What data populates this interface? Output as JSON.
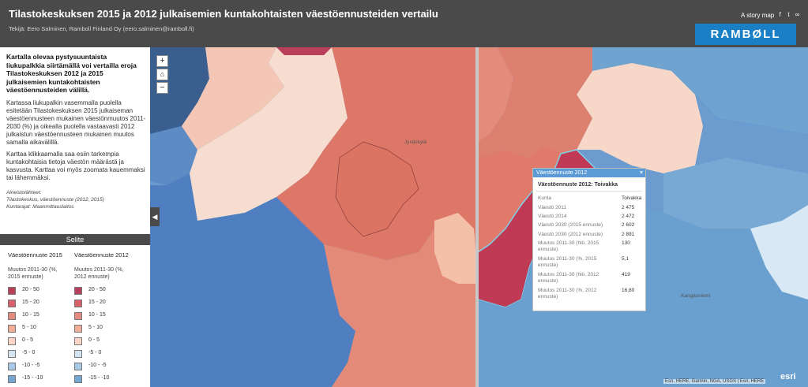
{
  "header": {
    "title": "Tilastokeskuksen 2015 ja 2012 julkaisemien kuntakohtaisten väestöennusteiden vertailu",
    "author": "Tekijä: Eero Salminen, Ramboll Finland Oy (eero.salminen@ramboll.fi)",
    "story_map": "A story map",
    "share_icons": [
      "facebook-icon",
      "twitter-icon",
      "link-icon"
    ],
    "logo": "RAMBØLL"
  },
  "panel": {
    "intro_bold": "Kartalla olevaa pystysuuntaista liukupalkkia siirtämällä voi vertailla eroja Tilastokeskuksen 2012 ja 2015 julkaisemien kuntakohtaisten väestöennusteiden välillä.",
    "p1": "Kartassa liukupalkin vasemmalla puolella esitetään Tilastokeskuksen 2015 julkaiseman väestöennusteen mukainen väestönmuutos 2011-2030 (%) ja oikealla puolella vastaavasti 2012 julkaistun väestöennusteen mukainen muutos samalla aikavälillä.",
    "p2": "Karttaa klikkaamalla saa esiin tarkempia kuntakohtaisia tietoja väestön määrästä ja kasvusta. Karttaa voi myös zoomata kauemmaksi tai lähemmäksi.",
    "sources_label": "Aineistolähteet:",
    "sources_1": "Tilastokeskus, väestöennuste (2012, 2015)",
    "sources_2": "Kuntarajat: Maanmittauslaitos"
  },
  "legend": {
    "header": "Selite",
    "col1_title": "Väestöennuste 2015",
    "col2_title": "Väestöennuste 2012",
    "col1_sub": "Muutos 2011-30 (%, 2015 ennuste)",
    "col2_sub": "Muutos 2011-30 (%, 2012 ennuste)",
    "classes": [
      {
        "label": "20 - 50",
        "color": "#b8405a"
      },
      {
        "label": "15 - 20",
        "color": "#d8606a"
      },
      {
        "label": "10 - 15",
        "color": "#e48a80"
      },
      {
        "label": "5 - 10",
        "color": "#f0ad98"
      },
      {
        "label": "0 - 5",
        "color": "#fad6c8"
      },
      {
        "label": "-5 - 0",
        "color": "#d6e5f2"
      },
      {
        "label": "-10 - -5",
        "color": "#a8c8e4"
      },
      {
        "label": "-15 - -10",
        "color": "#74a6d2"
      }
    ]
  },
  "map": {
    "zoom_in": "+",
    "zoom_out": "−",
    "home_icon": "home-icon",
    "toggle": "◀",
    "place_jyvaskyla": "Jyväskylä",
    "place_kangasniemi": "Kangasniemi",
    "attribution": "Esri, HERE, Garmin, NGA, USGS | Esri, HERE",
    "esri": "esri"
  },
  "popup": {
    "header": "Väestöennuste 2012",
    "close": "×",
    "title": "Väestöennuste 2012: Toivakka",
    "rows": [
      {
        "key": "Kunta",
        "value": "Toivakka"
      },
      {
        "key": "Väestö 2011",
        "value": "2 475"
      },
      {
        "key": "Väestö 2014",
        "value": "2 472"
      },
      {
        "key": "Väestö 2030 (2015 ennuste)",
        "value": "2 602"
      },
      {
        "key": "Väestö 2030 (2012 ennuste)",
        "value": "2 891"
      },
      {
        "key": "Muutos 2011-30 (hlö, 2015 ennuste)",
        "value": "130"
      },
      {
        "key": "Muutos 2011-30 (%, 2015 ennuste)",
        "value": "5,1"
      },
      {
        "key": "Muutos 2011-30 (hlö, 2012 ennuste)",
        "value": "419"
      },
      {
        "key": "Muutos 2011-30 (%, 2012 ennuste)",
        "value": "16,80"
      }
    ]
  }
}
